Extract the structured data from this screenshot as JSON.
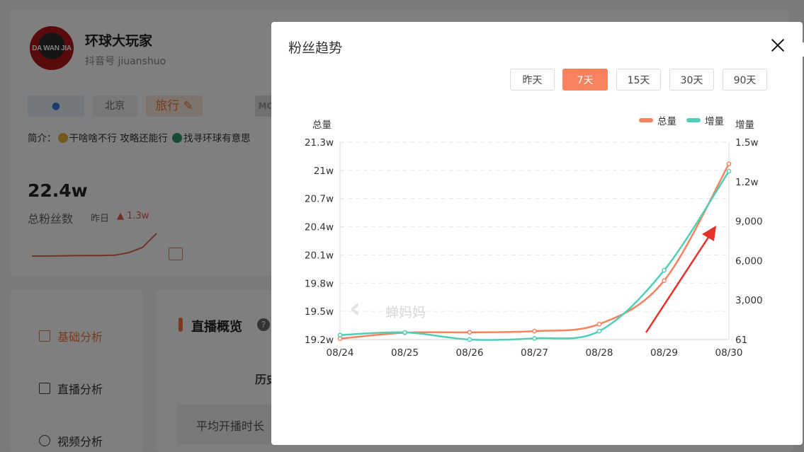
{
  "profile": {
    "avatar_text": "DA WAN JIA",
    "name": "环球大玩家",
    "account": "抖音号 jiuanshuo",
    "tags": {
      "city": "北京",
      "category": "旅行",
      "partial": "MC"
    },
    "intro_prefix": "简介：",
    "intro_part1": "干啥啥不行 攻略还能行",
    "intro_part2": "找寻环球有意思",
    "fans_count": "22.4w",
    "fans_label": "总粉丝数",
    "yesterday_label": "昨日",
    "yesterday_value": "▲ 1.3w",
    "sparkline": [
      10,
      10,
      10.2,
      10.5,
      10.6,
      10.6,
      11,
      14,
      20,
      36
    ]
  },
  "menu": {
    "items": [
      {
        "label": "基础分析",
        "active": true
      },
      {
        "label": "直播分析",
        "active": false
      },
      {
        "label": "视频分析",
        "active": false
      }
    ]
  },
  "live": {
    "title": "直播概览",
    "help": "?",
    "history_label": "历史",
    "avg_label": "平均开播时长"
  },
  "modal": {
    "title": "粉丝趋势",
    "ranges": [
      {
        "label": "昨天",
        "active": false
      },
      {
        "label": "7天",
        "active": true
      },
      {
        "label": "15天",
        "active": false
      },
      {
        "label": "30天",
        "active": false
      },
      {
        "label": "90天",
        "active": false
      }
    ],
    "watermark": "蝉妈妈"
  },
  "colors": {
    "total": "#f7835e",
    "increment": "#4fcfb7",
    "accent": "#f0763a"
  },
  "chart_data": {
    "type": "line",
    "x": [
      "08/24",
      "08/25",
      "08/26",
      "08/27",
      "08/28",
      "08/29",
      "08/30"
    ],
    "left_axis_label": "总量",
    "right_axis_label": "增量",
    "left_ticks": [
      "19.2w",
      "19.5w",
      "19.8w",
      "20.1w",
      "20.4w",
      "20.7w",
      "21w",
      "21.3w"
    ],
    "right_ticks": [
      "61",
      "3,000",
      "6,000",
      "9,000",
      "1.2w",
      "1.5w"
    ],
    "left_ylim": [
      191200,
      213000
    ],
    "right_ylim": [
      61,
      15000
    ],
    "series": [
      {
        "name": "总量",
        "axis": "left",
        "color": "#f7835e",
        "values": [
          191300,
          191950,
          192000,
          192130,
          192900,
          197700,
          210600
        ]
      },
      {
        "name": "增量",
        "axis": "right",
        "color": "#4fcfb7",
        "values": [
          400,
          600,
          61,
          150,
          700,
          5300,
          12800
        ]
      }
    ],
    "legend_position": "top-right",
    "grid": true
  }
}
